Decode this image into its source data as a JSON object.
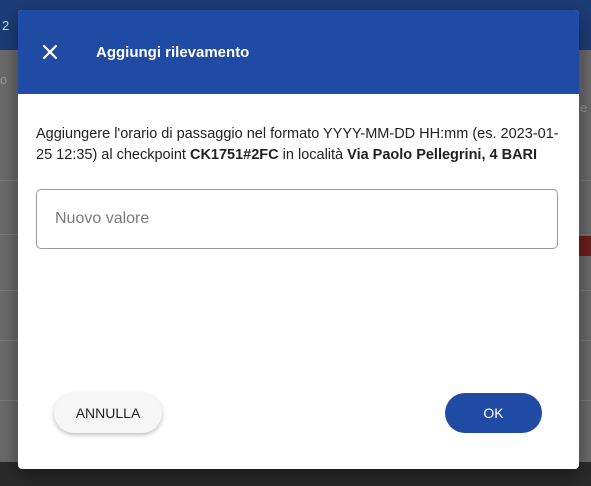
{
  "dialog": {
    "title": "Aggiungi rilevamento",
    "description": {
      "intro": "Aggiungere l'orario di passaggio nel formato YYYY-MM-DD HH:mm (es. 2023-01-25 12:35) al checkpoint ",
      "checkpoint": "CK1751#2FC",
      "middle": " in località ",
      "location": "Via Paolo Pellegrini, 4 BARI"
    },
    "input_placeholder": "Nuovo valore",
    "input_value": "",
    "cancel_label": "ANNULLA",
    "ok_label": "OK"
  },
  "background": {
    "header_fragment": "2",
    "left_fragment": "o",
    "right_fragment": "e"
  },
  "colors": {
    "primary": "#1f4ba5",
    "overlay": "#5a5a5a",
    "text": "#222222"
  },
  "icons": {
    "close": "close-icon"
  }
}
